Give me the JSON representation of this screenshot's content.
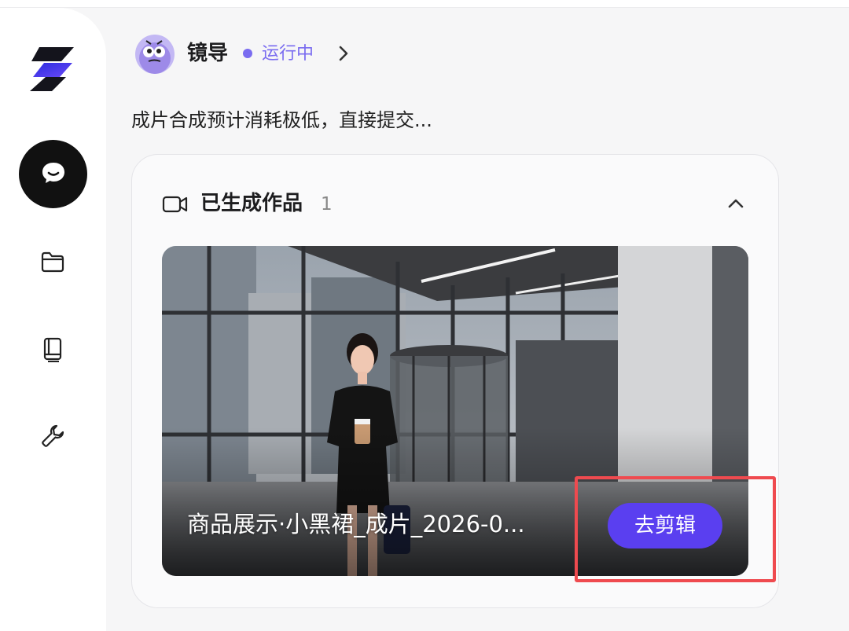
{
  "sidebar": {
    "logo_icon": "bolt-logo-icon",
    "items": [
      {
        "name": "chat",
        "icon": "chat-bubble-icon",
        "active": true
      },
      {
        "name": "folder",
        "icon": "folder-icon"
      },
      {
        "name": "library",
        "icon": "book-icon"
      },
      {
        "name": "tools",
        "icon": "wrench-icon"
      }
    ]
  },
  "header": {
    "agent_name": "镜导",
    "status": "运行中",
    "status_color": "#7a6cf0"
  },
  "message": "成片合成预计消耗极低，直接提交...",
  "works": {
    "label": "已生成作品",
    "count": "1",
    "items": [
      {
        "title": "商品展示·小黑裙_成片_2026-0...",
        "action_label": "去剪辑"
      }
    ]
  },
  "colors": {
    "accent": "#5a3ff0",
    "highlight": "#ef4a4f"
  }
}
